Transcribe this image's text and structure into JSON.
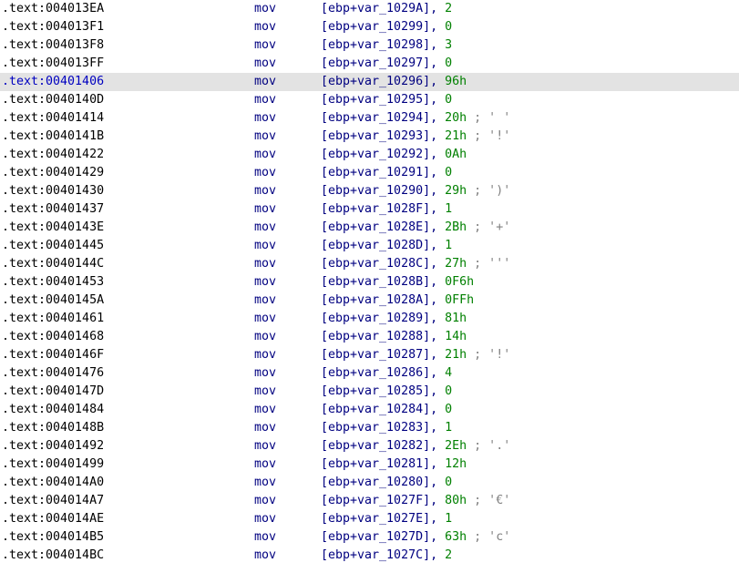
{
  "colors": {
    "address": "#000000",
    "selected_address": "#0000c0",
    "mnemonic": "#000080",
    "operand": "#000080",
    "immediate": "#008000",
    "comment": "#808080",
    "selected_row_bg": "#e3e3e3"
  },
  "rows": [
    {
      "addr": ".text:004013EA",
      "mnem": "mov",
      "var": "var_1029A",
      "val": "2",
      "cmt": ""
    },
    {
      "addr": ".text:004013F1",
      "mnem": "mov",
      "var": "var_10299",
      "val": "0",
      "cmt": ""
    },
    {
      "addr": ".text:004013F8",
      "mnem": "mov",
      "var": "var_10298",
      "val": "3",
      "cmt": ""
    },
    {
      "addr": ".text:004013FF",
      "mnem": "mov",
      "var": "var_10297",
      "val": "0",
      "cmt": ""
    },
    {
      "addr": ".text:00401406",
      "mnem": "mov",
      "var": "var_10296",
      "val": "96h",
      "cmt": "",
      "selected": true
    },
    {
      "addr": ".text:0040140D",
      "mnem": "mov",
      "var": "var_10295",
      "val": "0",
      "cmt": ""
    },
    {
      "addr": ".text:00401414",
      "mnem": "mov",
      "var": "var_10294",
      "val": "20h",
      "cmt": "; ' '"
    },
    {
      "addr": ".text:0040141B",
      "mnem": "mov",
      "var": "var_10293",
      "val": "21h",
      "cmt": "; '!'"
    },
    {
      "addr": ".text:00401422",
      "mnem": "mov",
      "var": "var_10292",
      "val": "0Ah",
      "cmt": ""
    },
    {
      "addr": ".text:00401429",
      "mnem": "mov",
      "var": "var_10291",
      "val": "0",
      "cmt": ""
    },
    {
      "addr": ".text:00401430",
      "mnem": "mov",
      "var": "var_10290",
      "val": "29h",
      "cmt": "; ')'"
    },
    {
      "addr": ".text:00401437",
      "mnem": "mov",
      "var": "var_1028F",
      "val": "1",
      "cmt": ""
    },
    {
      "addr": ".text:0040143E",
      "mnem": "mov",
      "var": "var_1028E",
      "val": "2Bh",
      "cmt": "; '+'"
    },
    {
      "addr": ".text:00401445",
      "mnem": "mov",
      "var": "var_1028D",
      "val": "1",
      "cmt": ""
    },
    {
      "addr": ".text:0040144C",
      "mnem": "mov",
      "var": "var_1028C",
      "val": "27h",
      "cmt": "; '''"
    },
    {
      "addr": ".text:00401453",
      "mnem": "mov",
      "var": "var_1028B",
      "val": "0F6h",
      "cmt": ""
    },
    {
      "addr": ".text:0040145A",
      "mnem": "mov",
      "var": "var_1028A",
      "val": "0FFh",
      "cmt": ""
    },
    {
      "addr": ".text:00401461",
      "mnem": "mov",
      "var": "var_10289",
      "val": "81h",
      "cmt": ""
    },
    {
      "addr": ".text:00401468",
      "mnem": "mov",
      "var": "var_10288",
      "val": "14h",
      "cmt": ""
    },
    {
      "addr": ".text:0040146F",
      "mnem": "mov",
      "var": "var_10287",
      "val": "21h",
      "cmt": "; '!'"
    },
    {
      "addr": ".text:00401476",
      "mnem": "mov",
      "var": "var_10286",
      "val": "4",
      "cmt": ""
    },
    {
      "addr": ".text:0040147D",
      "mnem": "mov",
      "var": "var_10285",
      "val": "0",
      "cmt": ""
    },
    {
      "addr": ".text:00401484",
      "mnem": "mov",
      "var": "var_10284",
      "val": "0",
      "cmt": ""
    },
    {
      "addr": ".text:0040148B",
      "mnem": "mov",
      "var": "var_10283",
      "val": "1",
      "cmt": ""
    },
    {
      "addr": ".text:00401492",
      "mnem": "mov",
      "var": "var_10282",
      "val": "2Eh",
      "cmt": "; '.'"
    },
    {
      "addr": ".text:00401499",
      "mnem": "mov",
      "var": "var_10281",
      "val": "12h",
      "cmt": ""
    },
    {
      "addr": ".text:004014A0",
      "mnem": "mov",
      "var": "var_10280",
      "val": "0",
      "cmt": ""
    },
    {
      "addr": ".text:004014A7",
      "mnem": "mov",
      "var": "var_1027F",
      "val": "80h",
      "cmt": "; '€'"
    },
    {
      "addr": ".text:004014AE",
      "mnem": "mov",
      "var": "var_1027E",
      "val": "1",
      "cmt": ""
    },
    {
      "addr": ".text:004014B5",
      "mnem": "mov",
      "var": "var_1027D",
      "val": "63h",
      "cmt": "; 'c'"
    },
    {
      "addr": ".text:004014BC",
      "mnem": "mov",
      "var": "var_1027C",
      "val": "2",
      "cmt": ""
    }
  ]
}
